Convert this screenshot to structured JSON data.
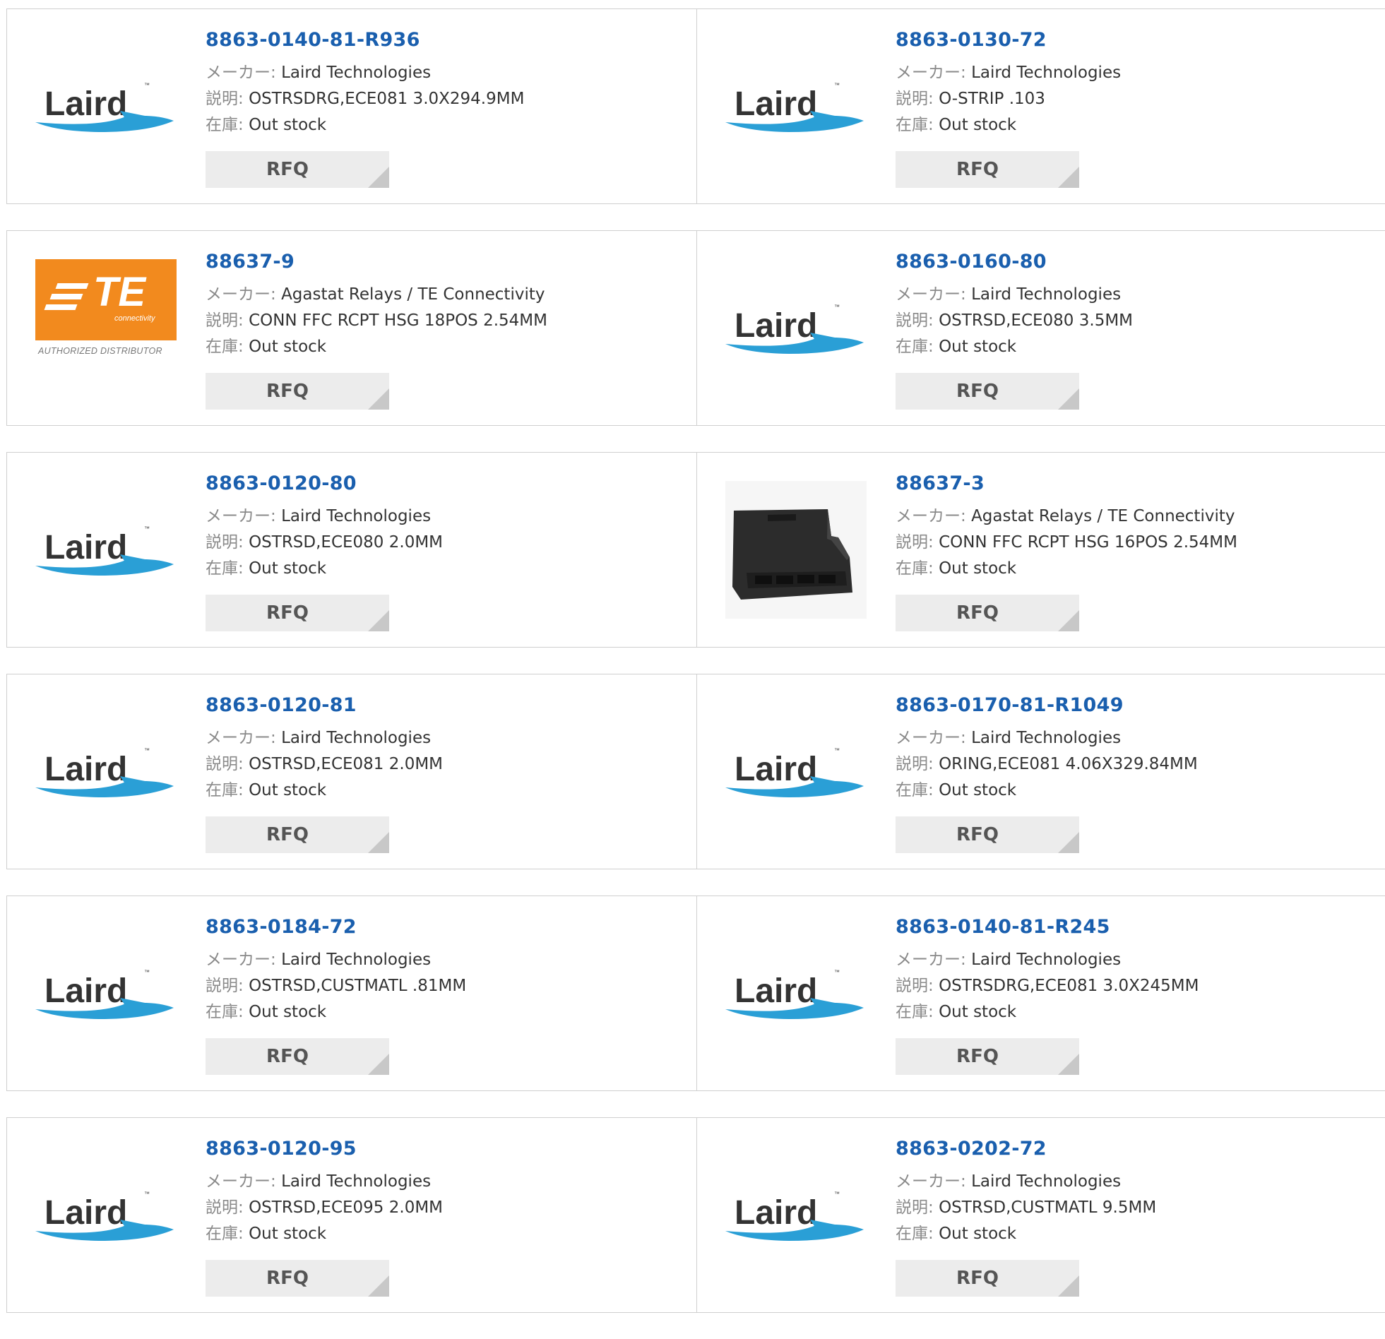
{
  "labels": {
    "maker": "メーカー:",
    "desc": "説明:",
    "stock": "在庫:",
    "rfq": "RFQ"
  },
  "logos": {
    "laird": {
      "text": "Laird",
      "brand_color": "#333333",
      "swoosh_color": "#2a9fd6"
    },
    "te": {
      "text": "TE",
      "sub": "connectivity",
      "caption": "AUTHORIZED DISTRIBUTOR",
      "brand_color": "#f28a1e"
    }
  },
  "colors": {
    "part_link": "#1a5fae",
    "label_gray": "#8a8a8a",
    "button_bg": "#ececec",
    "border": "#cfcfcf"
  },
  "rows": [
    {
      "left": {
        "logo": "laird",
        "part": "8863-0140-81-R936",
        "maker": "Laird Technologies",
        "desc": "OSTRSDRG,ECE081 3.0X294.9MM",
        "stock": "Out stock"
      },
      "right": {
        "logo": "laird",
        "part": "8863-0130-72",
        "maker": "Laird Technologies",
        "desc": "O-STRIP .103",
        "stock": "Out stock"
      }
    },
    {
      "left": {
        "logo": "te",
        "part": "88637-9",
        "maker": "Agastat Relays / TE Connectivity",
        "desc": "CONN FFC RCPT HSG 18POS 2.54MM",
        "stock": "Out stock"
      },
      "right": {
        "logo": "laird",
        "part": "8863-0160-80",
        "maker": "Laird Technologies",
        "desc": "OSTRSD,ECE080 3.5MM",
        "stock": "Out stock"
      }
    },
    {
      "left": {
        "logo": "laird",
        "part": "8863-0120-80",
        "maker": "Laird Technologies",
        "desc": "OSTRSD,ECE080 2.0MM",
        "stock": "Out stock"
      },
      "right": {
        "logo": "connector",
        "part": "88637-3",
        "maker": "Agastat Relays / TE Connectivity",
        "desc": "CONN FFC RCPT HSG 16POS 2.54MM",
        "stock": "Out stock"
      }
    },
    {
      "left": {
        "logo": "laird",
        "part": "8863-0120-81",
        "maker": "Laird Technologies",
        "desc": "OSTRSD,ECE081 2.0MM",
        "stock": "Out stock"
      },
      "right": {
        "logo": "laird",
        "part": "8863-0170-81-R1049",
        "maker": "Laird Technologies",
        "desc": "ORING,ECE081 4.06X329.84MM",
        "stock": "Out stock"
      }
    },
    {
      "left": {
        "logo": "laird",
        "part": "8863-0184-72",
        "maker": "Laird Technologies",
        "desc": "OSTRSD,CUSTMATL .81MM",
        "stock": "Out stock"
      },
      "right": {
        "logo": "laird",
        "part": "8863-0140-81-R245",
        "maker": "Laird Technologies",
        "desc": "OSTRSDRG,ECE081 3.0X245MM",
        "stock": "Out stock"
      }
    },
    {
      "left": {
        "logo": "laird",
        "part": "8863-0120-95",
        "maker": "Laird Technologies",
        "desc": "OSTRSD,ECE095 2.0MM",
        "stock": "Out stock"
      },
      "right": {
        "logo": "laird",
        "part": "8863-0202-72",
        "maker": "Laird Technologies",
        "desc": "OSTRSD,CUSTMATL 9.5MM",
        "stock": "Out stock"
      }
    }
  ]
}
